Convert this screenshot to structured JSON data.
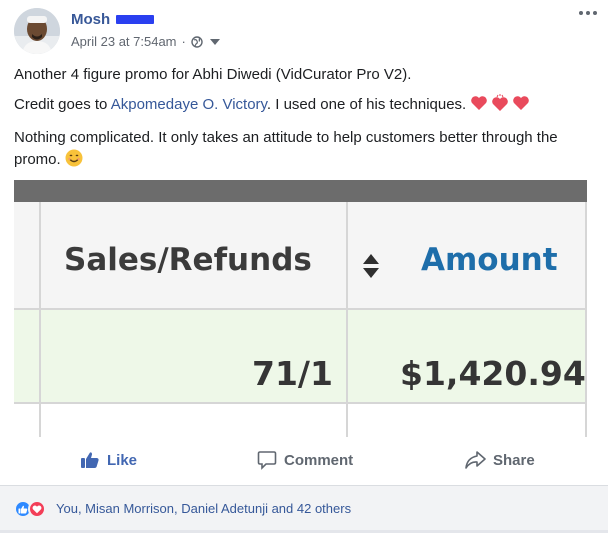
{
  "post": {
    "author_name": "Mosh",
    "timestamp": "April 23 at 7:54am",
    "meta_separator": "·",
    "audience_icon": "globe-icon",
    "lines": {
      "line1": "Another 4 figure promo for Abhi Diwedi (VidCurator Pro V2).",
      "line2_before": "Credit goes to ",
      "line2_link": "Akpomedaye O. Victory",
      "line2_after": ". I used one of his techniques. ",
      "line3": "Nothing complicated. It only takes an attitude to help customers better through the promo. "
    }
  },
  "image": {
    "col1_header": "Sales/Refunds",
    "col2_header": "Amount",
    "row1_sales": "71/1",
    "row1_amount": "$1,420.94"
  },
  "actions": {
    "like": "Like",
    "comment": "Comment",
    "share": "Share"
  },
  "reactions": {
    "text": "You, Misan Morrison, Daniel Adetunji and 42 others"
  },
  "colors": {
    "link": "#385898",
    "like_blue": "#4267b2",
    "amount_blue": "#1e6eaa",
    "love_red": "#f33e58"
  }
}
